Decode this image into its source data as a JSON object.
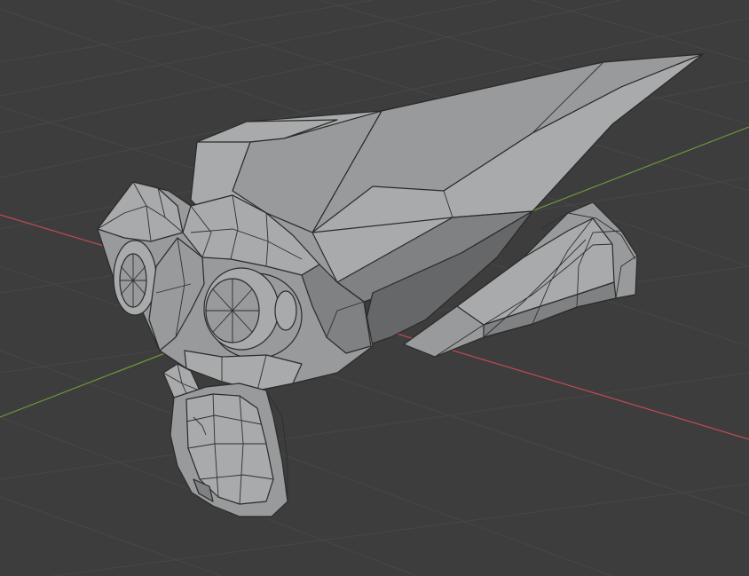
{
  "app": {
    "name": "3D Viewport"
  },
  "scene": {
    "background": "#3d3d3d",
    "grid_color": "#474747",
    "x_axis_color": "#c24a52",
    "y_axis_color": "#6c9a3c",
    "mesh_base_color": "#a9aaab",
    "mesh_edge_color": "#2a2a2a"
  },
  "objects": {
    "mesh": {
      "icon": "monkey-mesh",
      "shading": "solid"
    }
  }
}
